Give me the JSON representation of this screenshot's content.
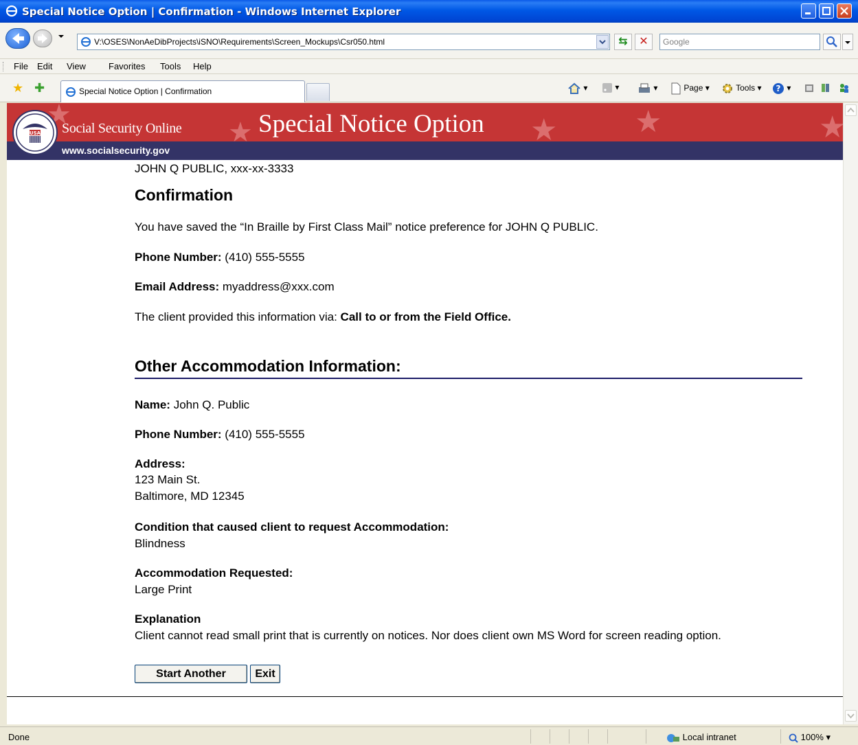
{
  "window": {
    "title": "Special Notice Option | Confirmation - Windows Internet Explorer"
  },
  "address_bar": {
    "url": "V:\\OSES\\NonAeDibProjects\\iSNO\\Requirements\\Screen_Mockups\\Csr050.html",
    "search_placeholder": "Google"
  },
  "menu": {
    "items": [
      "File",
      "Edit",
      "View",
      "Favorites",
      "Tools",
      "Help"
    ]
  },
  "tab": {
    "label": "Special Notice Option | Confirmation"
  },
  "command_bar": {
    "page_label": "Page",
    "tools_label": "Tools"
  },
  "banner": {
    "site_name": "Social Security Online",
    "url": "www.socialsecurity.gov",
    "heading": "Special Notice Option",
    "seal_text": "USA"
  },
  "content": {
    "client_line": "JOHN Q PUBLIC, xxx-xx-3333",
    "confirmation_heading": "Confirmation",
    "saved_message": "You have saved the “In Braille by First Class Mail” notice preference for JOHN Q PUBLIC.",
    "phone_label": "Phone Number:",
    "phone_value": " (410) 555-5555",
    "email_label": "Email Address:",
    "email_value": " myaddress@xxx.com",
    "provided_via_text": "The client provided this information via: ",
    "provided_via_value": "Call to or from the Field Office.",
    "other_heading": "Other Accommodation Information:",
    "name_label": "Name:",
    "name_value": " John Q. Public",
    "phone2_label": "Phone Number:",
    "phone2_value": " (410) 555-5555",
    "address_label": "Address:",
    "address_line1": "123 Main St.",
    "address_line2": "Baltimore, MD 12345",
    "condition_label": "Condition that caused client to request Accommodation:",
    "condition_value": "Blindness",
    "accommodation_label": "Accommodation Requested:",
    "accommodation_value": "Large Print",
    "explanation_label": "Explanation",
    "explanation_value": "Client cannot read small print that is currently on notices. Nor does client own MS Word for screen reading option."
  },
  "buttons": {
    "start_another": "Start Another",
    "exit": "Exit"
  },
  "status_bar": {
    "status": "Done",
    "zone": "Local intranet",
    "zoom": "100%"
  },
  "colors": {
    "banner_red": "#c53535",
    "banner_navy": "#333366"
  }
}
